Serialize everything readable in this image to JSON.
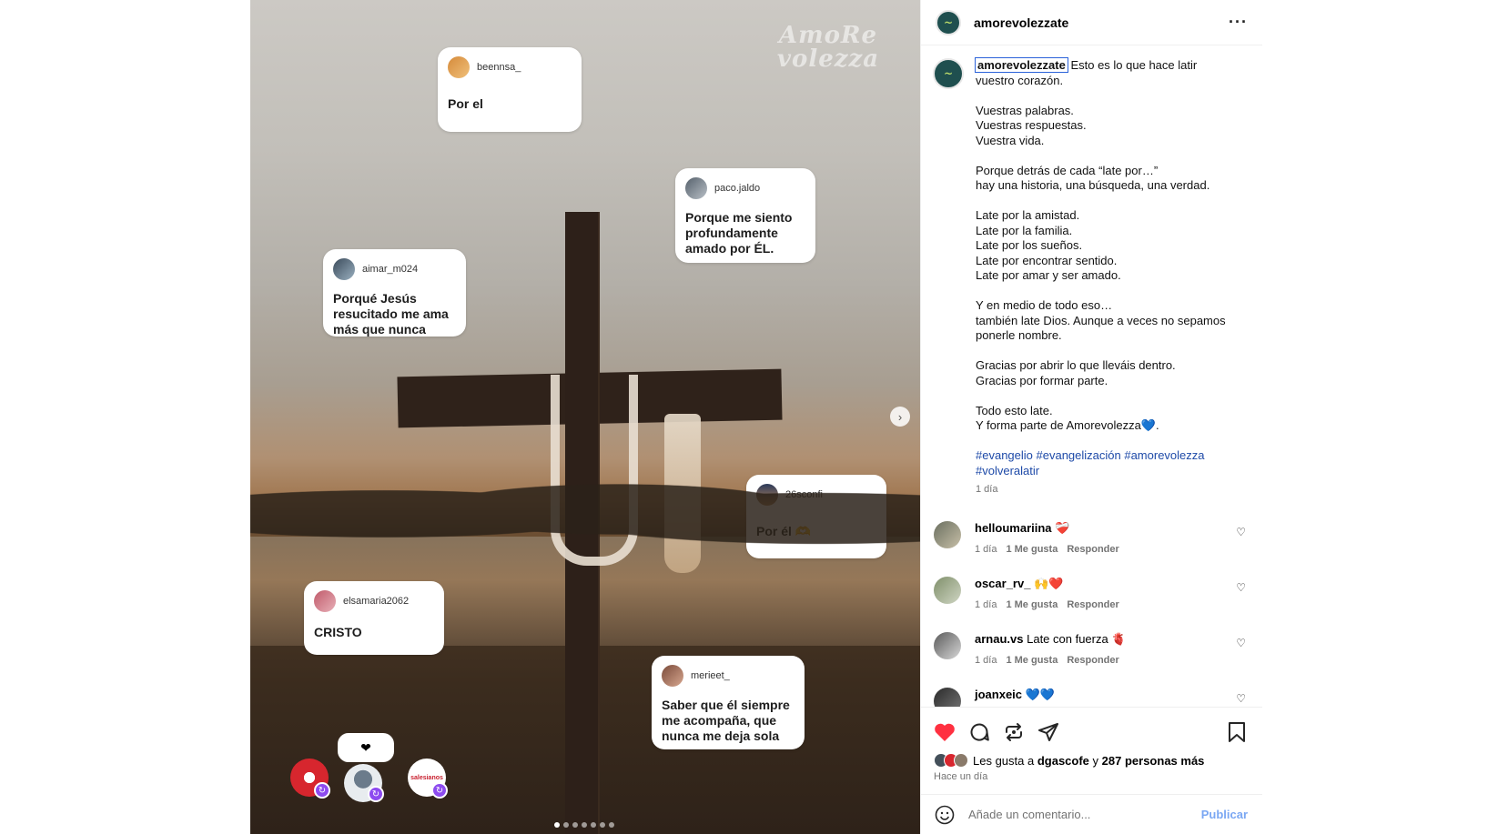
{
  "post": {
    "username": "amorevolezzate",
    "more_label": "···",
    "watermark": "AmoRe volezza",
    "next_arrow": "›",
    "cards": [
      {
        "user": "beennsa_",
        "text": "Por el"
      },
      {
        "user": "paco.jaldo",
        "text": "Porque me siento profundamente amado por ÉL."
      },
      {
        "user": "aimar_m024",
        "text": "Porqué Jesús resucitado me ama más que nunca"
      },
      {
        "user": "26sconfi",
        "text": "Por él 🫶"
      },
      {
        "user": "elsamaria2062",
        "text": "CRISTO"
      },
      {
        "user": "merieet_",
        "text": "Saber que él siempre me acompaña, que nunca me deja sola"
      }
    ],
    "heart_bubble": "❤",
    "bubble_badge": "↻",
    "bubble_label_3": "salesianos",
    "carousel": {
      "total": 7,
      "active": 0
    }
  },
  "caption": {
    "username": "amorevolezzate",
    "lines": [
      "Esto es lo que hace latir",
      "vuestro corazón.",
      "",
      "Vuestras palabras.",
      "Vuestras respuestas.",
      "Vuestra vida.",
      "",
      "Porque detrás de cada “late por…”",
      "hay una historia, una búsqueda, una verdad.",
      "",
      "Late por la amistad.",
      "Late por la familia.",
      "Late por los sueños.",
      "Late por encontrar sentido.",
      "Late por amar y ser amado.",
      "",
      "Y en medio de todo eso…",
      "también late Dios. Aunque a veces no sepamos",
      "ponerle nombre.",
      "",
      "Gracias por abrir lo que lleváis dentro.",
      "Gracias por formar parte.",
      "",
      "Todo esto late.",
      "Y forma parte de Amorevolezza💙."
    ],
    "hashtags_line1": "#evangelio #evangelización #amorevolezza",
    "hashtags_line2": "#volveralatir",
    "time": "1 día"
  },
  "comments": [
    {
      "user": "helloumariina",
      "text": "❤️‍🩹",
      "time": "1 día",
      "likes": "1 Me gusta",
      "reply": "Responder"
    },
    {
      "user": "oscar_rv_",
      "text": "🙌❤️",
      "time": "1 día",
      "likes": "1 Me gusta",
      "reply": "Responder"
    },
    {
      "user": "arnau.vs",
      "text": "Late con fuerza 🫀",
      "time": "1 día",
      "likes": "1 Me gusta",
      "reply": "Responder"
    },
    {
      "user": "joanxeic",
      "text": "💙💙",
      "time": "",
      "likes": "",
      "reply": ""
    }
  ],
  "likes": {
    "prefix": "Les gusta a",
    "user": "dgascofe",
    "joiner": "y",
    "others": "287 personas más",
    "posted": "Hace un día"
  },
  "comment_box": {
    "placeholder": "Añade un comentario...",
    "publish": "Publicar"
  },
  "colors": {
    "heart": "#ff3040",
    "link": "#1e4aa8",
    "publish": "#7aa7f3",
    "badge": "#8d4bf0"
  },
  "icons": [
    "more-icon",
    "next-arrow-icon",
    "heart-icon",
    "comment-icon",
    "repost-icon",
    "share-icon",
    "bookmark-icon",
    "emoji-icon",
    "like-outline-icon"
  ]
}
